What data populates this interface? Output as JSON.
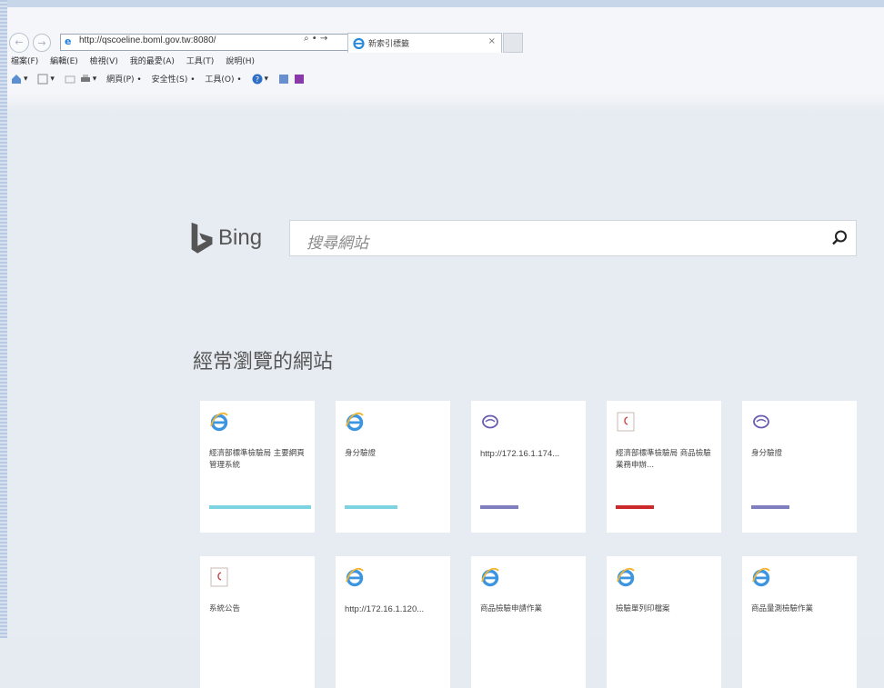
{
  "browser": {
    "address": "http://qscoeline.boml.gov.tw:8080/",
    "address_controls": "⌕ • →",
    "tab_title": "新索引標籤",
    "tab_close": "×",
    "menu": [
      "檔案(F)",
      "編輯(E)",
      "檢視(V)",
      "我的最愛(A)",
      "工具(T)",
      "說明(H)"
    ],
    "commands": [
      "網頁(P) •",
      "安全性(S) •",
      "工具(O) •"
    ]
  },
  "bing": {
    "logo_text": "Bing",
    "placeholder": "搜尋網站"
  },
  "frequent": {
    "title": "經常瀏覽的網站",
    "tiles": [
      {
        "label": "經濟部標準檢驗局 主要網頁管理系統",
        "icon": "ie-icon",
        "bar": "#7dd3e0"
      },
      {
        "label": "身分驗證",
        "icon": "ie-icon",
        "bar": "#7dd3e0"
      },
      {
        "label": "http://172.16.1.174...",
        "icon": "globe-icon",
        "bar": "#7f7fc0"
      },
      {
        "label": "經濟部標準檢驗局 商品檢驗業務申辦...",
        "icon": "page-icon",
        "bar": "#cc2a2a"
      },
      {
        "label": "身分驗證",
        "icon": "globe-icon",
        "bar": "#7f7fc0"
      },
      {
        "label": "系統公告",
        "icon": "page-icon",
        "bar": ""
      },
      {
        "label": "http://172.16.1.120...",
        "icon": "ie-icon",
        "bar": ""
      },
      {
        "label": "商品檢驗申請作業",
        "icon": "ie-icon",
        "bar": ""
      },
      {
        "label": "檢驗單列印檔案",
        "icon": "ie-icon",
        "bar": ""
      },
      {
        "label": "商品量測檢驗作業",
        "icon": "ie-icon",
        "bar": ""
      }
    ]
  }
}
